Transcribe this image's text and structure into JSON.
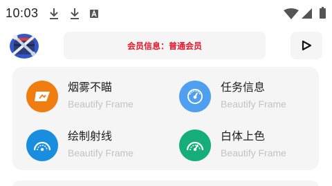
{
  "status_bar": {
    "time": "10:03",
    "left_icons": [
      "download-icon",
      "download-icon",
      "a-box-icon"
    ],
    "right_icons": [
      "wifi-icon",
      "signal-icon",
      "battery-icon"
    ]
  },
  "header": {
    "logo_icon": "tools-logo-icon",
    "member_info": "会员信息：普通会员",
    "member_color": "#e8192c",
    "play_icon": "play-icon"
  },
  "features": [
    {
      "title": "烟雾不瞄",
      "subtitle": "Beautify Frame",
      "icon": "smoke-icon",
      "color": "#f07d10"
    },
    {
      "title": "任务信息",
      "subtitle": "Beautify Frame",
      "icon": "gauge-icon",
      "color": "#4e9ff0"
    },
    {
      "title": "绘制射线",
      "subtitle": "Beautify Frame",
      "icon": "rays-icon",
      "color": "#1a8ede"
    },
    {
      "title": "白体上色",
      "subtitle": "Beautify Frame",
      "icon": "color-icon",
      "color": "#15ae7b"
    }
  ]
}
